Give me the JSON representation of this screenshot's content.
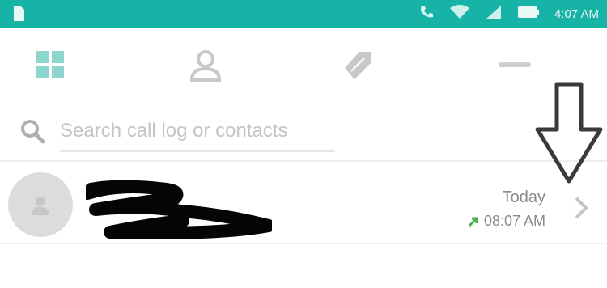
{
  "status_bar": {
    "time": "4:07 AM",
    "icons": [
      "sd-card-icon",
      "phone-icon",
      "wifi-icon",
      "signal-icon",
      "battery-icon"
    ],
    "color": "#17b3a6"
  },
  "tabs": {
    "items": [
      {
        "name": "dialpad",
        "icon": "grid-icon",
        "active": true
      },
      {
        "name": "contacts",
        "icon": "person-icon"
      },
      {
        "name": "favorites",
        "icon": "tags-icon"
      },
      {
        "name": "more",
        "icon": "more-icon"
      }
    ],
    "active_color": "#8ed6cd"
  },
  "search": {
    "placeholder": "Search call log or contacts"
  },
  "call_log": [
    {
      "contact_name": "",
      "date": "Today",
      "time": "08:07 AM",
      "call_type": "outgoing",
      "call_type_color": "#4caf50"
    }
  ]
}
